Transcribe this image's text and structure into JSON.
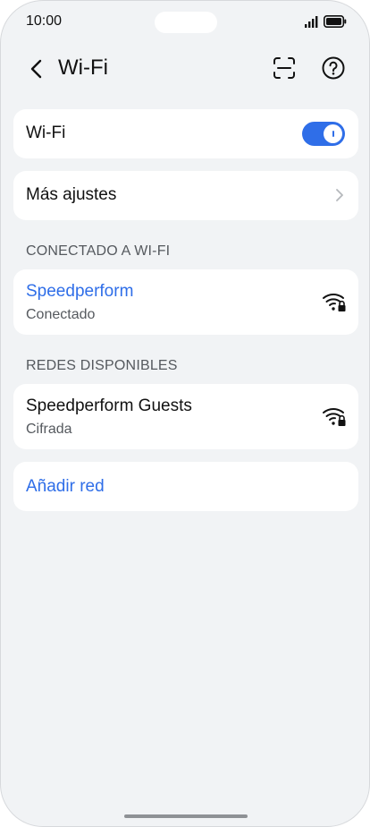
{
  "status_bar": {
    "time": "10:00"
  },
  "header": {
    "title": "Wi-Fi",
    "back_icon": "chevron-left-icon",
    "scan_icon": "scan-frame-icon",
    "help_icon": "help-circle-icon"
  },
  "wifi_toggle": {
    "label": "Wi-Fi",
    "state": "on"
  },
  "more_settings": {
    "label": "Más ajustes"
  },
  "connected_section": {
    "header": "CONECTADO A WI-FI",
    "network": {
      "name": "Speedperform",
      "status": "Conectado",
      "icon": "wifi-lock-icon"
    }
  },
  "available_section": {
    "header": "REDES DISPONIBLES",
    "networks": [
      {
        "name": "Speedperform Guests",
        "status": "Cifrada",
        "icon": "wifi-lock-icon"
      }
    ]
  },
  "add_network": {
    "label": "Añadir red"
  },
  "colors": {
    "accent": "#2f6ee8",
    "background": "#f1f3f5",
    "card": "#ffffff",
    "secondary_text": "#55595e"
  }
}
